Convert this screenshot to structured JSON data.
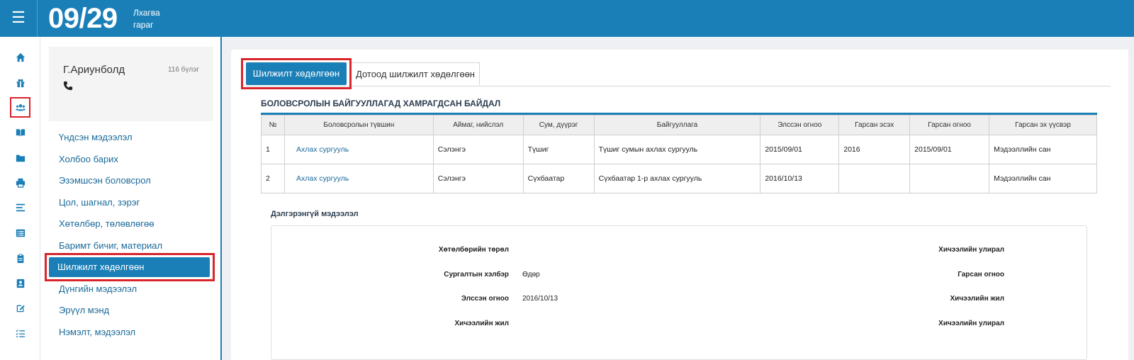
{
  "header": {
    "date": "09/29",
    "weekday_line1": "Лхагва",
    "weekday_line2": "гараг"
  },
  "rail": {
    "icons": [
      "home-icon",
      "gift-icon",
      "users-icon",
      "book-open-icon",
      "folder-icon",
      "print-icon",
      "align-icon",
      "list-icon",
      "clipboard-icon",
      "address-card-icon",
      "edit-icon",
      "task-list-icon"
    ],
    "highlighted": "users-icon"
  },
  "profile": {
    "name": "Г.Ариунболд",
    "groups": "116 бүлэг"
  },
  "menu": {
    "items": [
      {
        "label": "Үндсэн мэдээлэл"
      },
      {
        "label": "Холбоо барих"
      },
      {
        "label": "Эзэмшсэн боловсрол"
      },
      {
        "label": "Цол, шагнал, зэрэг"
      },
      {
        "label": "Хөтөлбөр, төлөвлөгөө"
      },
      {
        "label": "Баримт бичиг, материал"
      },
      {
        "label": "Шилжилт хөдөлгөөн"
      },
      {
        "label": "Дүнгийн мэдээлэл"
      },
      {
        "label": "Эрүүл мэнд"
      },
      {
        "label": "Нэмэлт, мэдээлэл"
      }
    ],
    "active_index": 6
  },
  "tabs": {
    "active": "Шилжилт хөдөлгөөн",
    "inactive": "Дотоод шилжилт хөдөлгөөн"
  },
  "section": {
    "title": "БОЛОВСРОЛЫН БАЙГУУЛЛАГАД ХАМРАГДСАН БАЙДАЛ"
  },
  "table": {
    "headers": [
      "№",
      "Боловсролын түвшин",
      "Аймаг, нийслэл",
      "Сум, дүүрэг",
      "Байгууллага",
      "Элссэн огноо",
      "Гарсан эсэх",
      "Гарсан огноо",
      "Гарсан эх үүсвэр"
    ],
    "rows": [
      [
        "1",
        "Ахлах сургууль",
        "Сэлэнгэ",
        "Түшиг",
        "Түшиг сумын ахлах сургууль",
        "2015/09/01",
        "2016",
        "2015/09/01",
        "Мэдээллийн сан"
      ],
      [
        "2",
        "Ахлах сургууль",
        "Сэлэнгэ",
        "Сүхбаатар",
        "Сүхбаатар 1-р ахлах сургууль",
        "2016/10/13",
        "",
        "",
        "Мэдээллийн сан"
      ]
    ]
  },
  "details": {
    "title": "Дэлгэрэнгүй мэдээлэл",
    "left": [
      {
        "label": "Хөтөлбөрийн төрөл",
        "value": ""
      },
      {
        "label": "Сургалтын хэлбэр",
        "value": "Өдөр"
      },
      {
        "label": "Элссэн огноо",
        "value": "2016/10/13"
      },
      {
        "label": "Хичээлийн жил",
        "value": ""
      }
    ],
    "right": [
      {
        "label": "Хичээлийн улирал",
        "value": ""
      },
      {
        "label": "Гарсан огноо",
        "value": ""
      },
      {
        "label": "Хичээлийн жил",
        "value": ""
      },
      {
        "label": "Хичээлийн улирал",
        "value": ""
      }
    ]
  },
  "colors": {
    "primary": "#1b7fb7",
    "highlight": "#d9242c",
    "link": "#1b6a9a"
  }
}
